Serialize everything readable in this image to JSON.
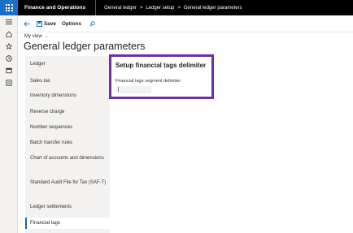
{
  "topbar": {
    "app_title": "Finance and Operations",
    "breadcrumbs": [
      "General ledger",
      "Ledger setup",
      "General ledger parameters"
    ],
    "separator": ">"
  },
  "nav": {
    "icons": [
      "menu-icon",
      "home-icon",
      "star-icon",
      "clock-icon",
      "workspace-icon",
      "list-icon"
    ]
  },
  "actionbar": {
    "back_icon": "back-arrow-icon",
    "save_label": "Save",
    "options_label": "Options",
    "search_icon": "search-icon"
  },
  "header": {
    "view_label": "My view",
    "page_title": "General ledger parameters"
  },
  "sidebar": {
    "items": [
      {
        "label": "Ledger",
        "selected": false
      },
      {
        "label": "Sales tax",
        "selected": false
      },
      {
        "label": "Inventory dimensions",
        "selected": false
      },
      {
        "label": "Reverse charge",
        "selected": false
      },
      {
        "label": "Number sequences",
        "selected": false
      },
      {
        "label": "Batch transfer rules",
        "selected": false
      },
      {
        "label": "Chart of accounts and dimensions",
        "selected": false
      },
      {
        "label": "Standard Audit File for Tax (SAF-T)",
        "selected": false
      },
      {
        "label": "Ledger settlements",
        "selected": false
      },
      {
        "label": "Financial tags",
        "selected": true
      }
    ]
  },
  "main": {
    "section_title": "Setup financial tags delimiter",
    "field_label": "Financial tags segment delimiter",
    "field_value": "",
    "highlight_color": "#6b2fa8"
  },
  "colors": {
    "accent": "#0f6cbd",
    "topbar": "#000000",
    "waffle": "#1a6fc9",
    "highlight": "#6b2fa8"
  }
}
